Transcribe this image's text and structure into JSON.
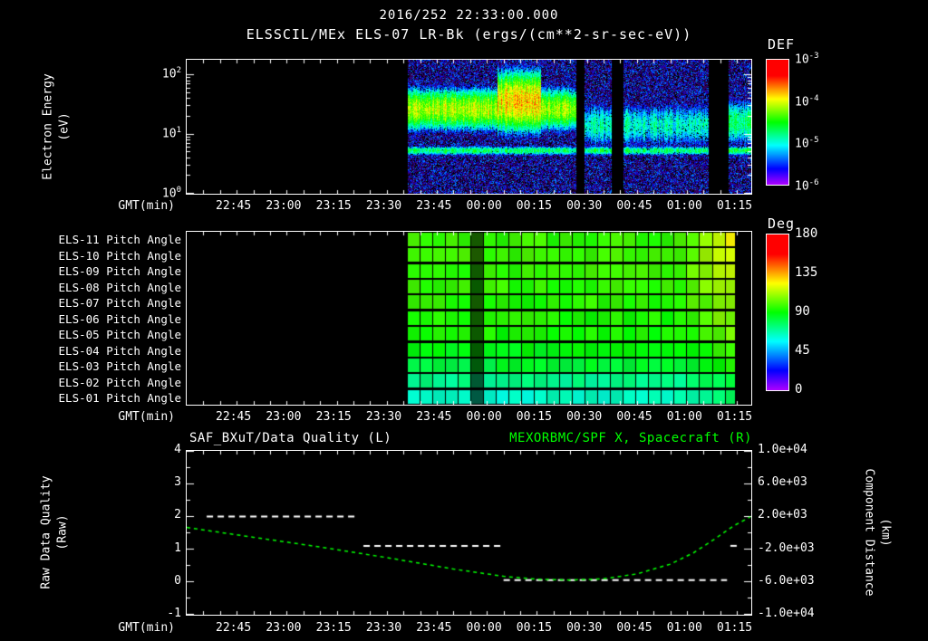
{
  "title": "2016/252 22:33:00.000",
  "subtitle": "ELSSCIL/MEx ELS-07 LR-Bk (ergs/(cm**2-sr-sec-eV))",
  "colors": {
    "background": "#000000",
    "foreground": "#ffffff",
    "right_series_green": "#00ff00"
  },
  "time_axis": {
    "label": "GMT(min)",
    "start_gmt": "22:31",
    "end_gmt": "01:20",
    "range_minutes": 169,
    "minor_tick_minutes": 5,
    "major_ticks": [
      {
        "label": "22:45",
        "minute": 14
      },
      {
        "label": "23:00",
        "minute": 29
      },
      {
        "label": "23:15",
        "minute": 44
      },
      {
        "label": "23:30",
        "minute": 59
      },
      {
        "label": "23:45",
        "minute": 74
      },
      {
        "label": "00:00",
        "minute": 89
      },
      {
        "label": "00:15",
        "minute": 104
      },
      {
        "label": "00:30",
        "minute": 119
      },
      {
        "label": "00:45",
        "minute": 134
      },
      {
        "label": "01:00",
        "minute": 149
      },
      {
        "label": "01:15",
        "minute": 164
      }
    ]
  },
  "panels": {
    "spectrogram": {
      "ylabel1": "Electron Energy",
      "ylabel2": "(eV)",
      "y_log_range": [
        0,
        2.25
      ],
      "y_ticks": [
        {
          "label": "10^2",
          "log10_ev": 2
        },
        {
          "label": "10^1",
          "log10_ev": 1
        },
        {
          "label": "10^0",
          "log10_ev": 0
        }
      ],
      "colorbar": {
        "title": "DEF",
        "tick_labels": [
          "10^-3",
          "10^-4",
          "10^-5",
          "10^-6"
        ],
        "log10_flux_range": [
          -6,
          -3
        ]
      }
    },
    "pitch": {
      "colorbar": {
        "title": "Deg",
        "tick_values": [
          180,
          135,
          90,
          45,
          0
        ],
        "range_deg": [
          0,
          180
        ]
      }
    },
    "timeseries": {
      "title_left": "SAF_BXuT/Data Quality (L)",
      "title_right": "MEXORBMC/SPF X, Spacecraft (R)",
      "ylabel_left1": "Raw Data Quality",
      "ylabel_left2": "(Raw)",
      "ylabel_right1": "Component Distance",
      "ylabel_right2": "(km)",
      "y_ticks_left": [
        4,
        3,
        2,
        1,
        0,
        -1
      ],
      "y_ticks_right": [
        "1.0e+04",
        "6.0e+03",
        "2.0e+03",
        "-2.0e+03",
        "-6.0e+03",
        "-1.0e+04"
      ],
      "ylim_left": [
        -1,
        4
      ],
      "ylim_right_km": [
        -10000,
        10000
      ]
    }
  },
  "chart_data": [
    {
      "type": "heatmap",
      "name": "electron-energy-spectrogram",
      "title": "ELSSCIL/MEx ELS-07 LR-Bk",
      "units": "ergs/(cm**2-sr-sec-eV)",
      "colorbar_label": "DEF",
      "x_axis": "GMT 22:31 to 01:20 (minutes 0-169)",
      "y_axis": "Electron Energy 1-178 eV, log scale",
      "color_log10_range": [
        -6,
        -3
      ],
      "data_start_min": 66,
      "gaps_min": [
        [
          116.5,
          119
        ],
        [
          127,
          130.5
        ],
        [
          156,
          162
        ]
      ],
      "background_log10_flux": [
        -6.3,
        -5.3
      ],
      "bands": [
        {
          "t": [
            66,
            116.5
          ],
          "center_log10_ev": 1.42,
          "sigma": 0.3,
          "peak_log10_flux": -4.15,
          "desc": "main electron band ~15-45 eV from 23:37 to 00:28"
        },
        {
          "t": [
            93,
            106
          ],
          "center_log10_ev": 1.55,
          "sigma": 0.42,
          "peak_log10_flux": -3.85,
          "desc": "bright enhancement around 00:05-00:15"
        },
        {
          "t": [
            119,
            156
          ],
          "center_log10_ev": 1.15,
          "sigma": 0.35,
          "peak_log10_flux": -4.95,
          "desc": "weaker diffuse band after 00:30"
        },
        {
          "t": [
            162,
            169
          ],
          "center_log10_ev": 1.2,
          "sigma": 0.35,
          "peak_log10_flux": -4.8,
          "desc": "band resumes at right edge"
        },
        {
          "t": [
            66,
            169
          ],
          "center_log10_ev": 0.72,
          "sigma": 0.07,
          "peak_log10_flux": -4.7,
          "desc": "narrow ~5 eV line"
        }
      ]
    },
    {
      "type": "heatmap",
      "name": "pitch-angle-panels",
      "colorbar_label": "Deg",
      "range_deg": [
        0,
        180
      ],
      "data_start_min": 66,
      "data_end_min": 164,
      "cell_minutes": 3.8,
      "dark_column_min": 85,
      "yellow_trend_start_min": 145,
      "rows": [
        {
          "label": "ELS-11 Pitch Angle",
          "base_deg": 97,
          "end_deg": 128
        },
        {
          "label": "ELS-10 Pitch Angle",
          "base_deg": 98,
          "end_deg": 124
        },
        {
          "label": "ELS-09 Pitch Angle",
          "base_deg": 97,
          "end_deg": 120
        },
        {
          "label": "ELS-08 Pitch Angle",
          "base_deg": 96,
          "end_deg": 117
        },
        {
          "label": "ELS-07 Pitch Angle",
          "base_deg": 95,
          "end_deg": 114
        },
        {
          "label": "ELS-06 Pitch Angle",
          "base_deg": 94,
          "end_deg": 111
        },
        {
          "label": "ELS-05 Pitch Angle",
          "base_deg": 92,
          "end_deg": 107
        },
        {
          "label": "ELS-04 Pitch Angle",
          "base_deg": 88,
          "end_deg": 101
        },
        {
          "label": "ELS-03 Pitch Angle",
          "base_deg": 83,
          "end_deg": 95
        },
        {
          "label": "ELS-02 Pitch Angle",
          "base_deg": 71,
          "end_deg": 85
        },
        {
          "label": "ELS-01 Pitch Angle",
          "base_deg": 63,
          "end_deg": 79
        }
      ]
    },
    {
      "type": "line",
      "name": "quality-and-distance",
      "x_axis": "GMT minutes since 22:31 (0-169)",
      "ylim_left": [
        -1,
        4
      ],
      "ylim_right": [
        -10000,
        10000
      ],
      "series": [
        {
          "name": "SAF_BXuT/Data Quality (L)",
          "axis": "left",
          "color": "#ffffff",
          "line_style": "dashed",
          "segments": [
            {
              "value": 2.0,
              "t": [
                6,
                51
              ]
            },
            {
              "value": 1.1,
              "t": [
                53,
                95
              ]
            },
            {
              "value": 0.05,
              "t": [
                95,
                162
              ]
            },
            {
              "value": 1.1,
              "t": [
                163,
                165
              ]
            }
          ]
        },
        {
          "name": "MEXORBMC/SPF X, Spacecraft (R)",
          "axis": "right",
          "color": "#00ff00",
          "line_style": "dashed",
          "points": [
            [
              0,
              600
            ],
            [
              20,
              -600
            ],
            [
              40,
              -1800
            ],
            [
              60,
              -3100
            ],
            [
              80,
              -4500
            ],
            [
              95,
              -5400
            ],
            [
              105,
              -5750
            ],
            [
              115,
              -5850
            ],
            [
              125,
              -5700
            ],
            [
              135,
              -5100
            ],
            [
              145,
              -3900
            ],
            [
              152,
              -2500
            ],
            [
              158,
              -900
            ],
            [
              164,
              800
            ],
            [
              169,
              1900
            ]
          ]
        }
      ]
    }
  ]
}
